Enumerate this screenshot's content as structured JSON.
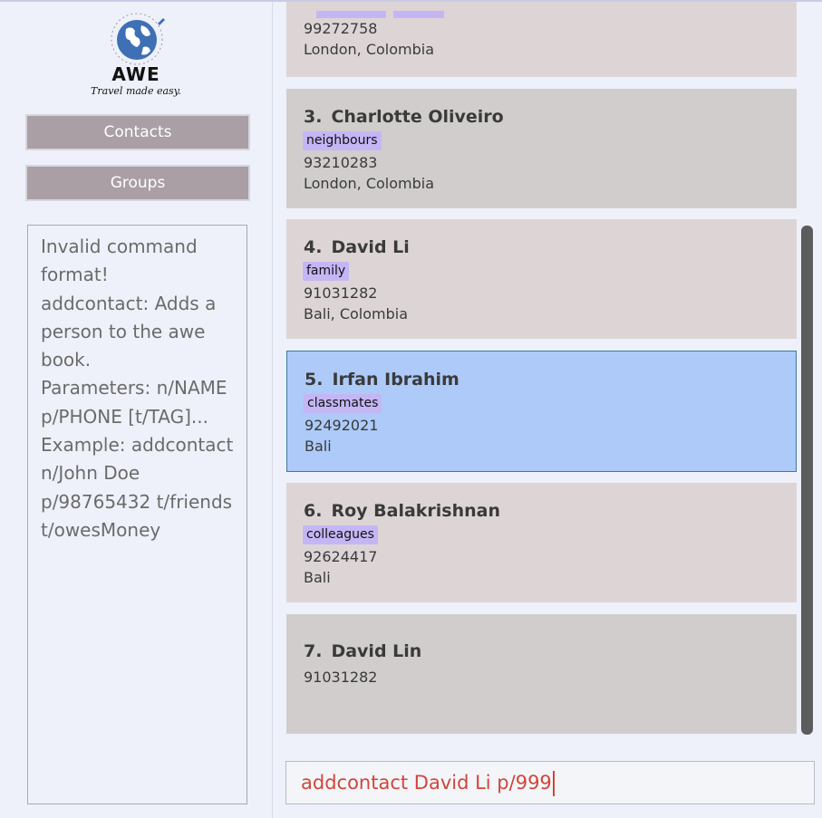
{
  "app": {
    "logo_text": "AWE",
    "tagline": "Travel made easy."
  },
  "nav": {
    "contacts_label": "Contacts",
    "groups_label": "Groups"
  },
  "result_display": {
    "text": "Invalid command format!\naddcontact: Adds a person to the awe book.\nParameters: n/NAME p/PHONE [t/TAG]...\nExample: addcontact n/John Doe p/98765432 t/friends t/owesMoney"
  },
  "contacts": [
    {
      "phone": "99272758",
      "address": "London, Colombia"
    },
    {
      "index": "3.",
      "name": "Charlotte Oliveiro",
      "tag": "neighbours",
      "phone": "93210283",
      "address": "London, Colombia"
    },
    {
      "index": "4.",
      "name": "David Li",
      "tag": "family",
      "phone": "91031282",
      "address": "Bali, Colombia"
    },
    {
      "index": "5.",
      "name": "Irfan Ibrahim",
      "tag": "classmates",
      "phone": "92492021",
      "address": "Bali"
    },
    {
      "index": "6.",
      "name": "Roy Balakrishnan",
      "tag": "colleagues",
      "phone": "92624417",
      "address": "Bali"
    },
    {
      "index": "7.",
      "name": "David Lin",
      "phone": "91031282"
    }
  ],
  "command_box": {
    "value": "addcontact David Li p/999"
  },
  "colors": {
    "nav_button": "#a99fa4",
    "tag_bg": "#c4b6f5",
    "selected_card": "#adcaf8",
    "command_text": "#d0463a"
  }
}
